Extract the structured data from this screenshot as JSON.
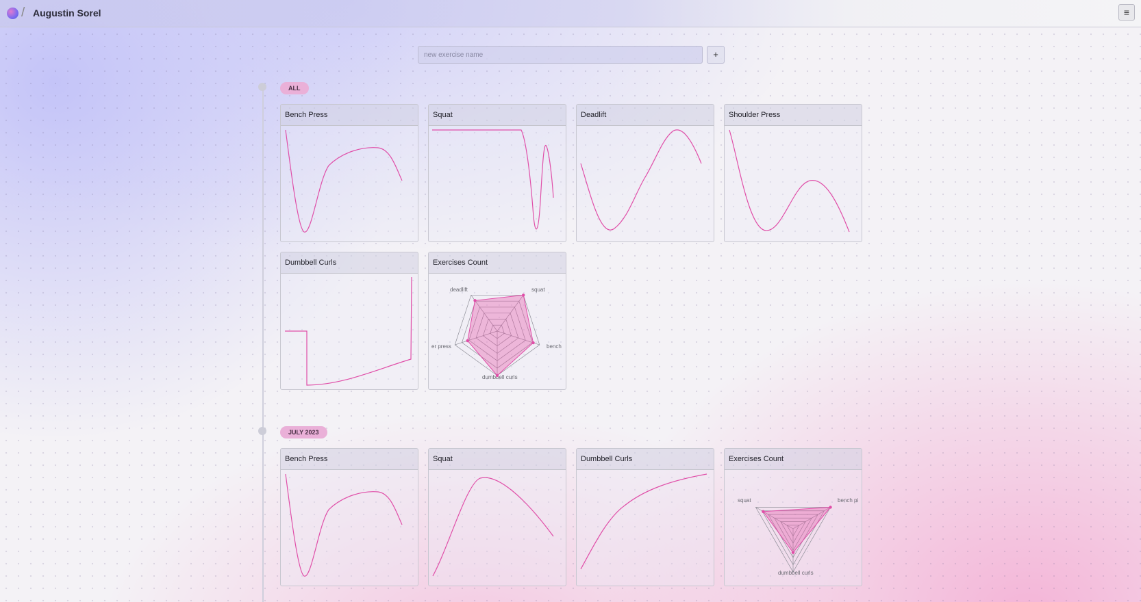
{
  "header": {
    "username": "Augustin Sorel",
    "separator": "/",
    "menu_icon": "≡"
  },
  "new_exercise": {
    "placeholder": "new exercise name",
    "add_label": "+"
  },
  "sections": [
    {
      "label": "ALL",
      "cards": [
        {
          "title": "Bench Press",
          "kind": "line"
        },
        {
          "title": "Squat",
          "kind": "line"
        },
        {
          "title": "Deadlift",
          "kind": "line"
        },
        {
          "title": "Shoulder Press",
          "kind": "line"
        },
        {
          "title": "Dumbbell Curls",
          "kind": "line"
        },
        {
          "title": "Exercises Count",
          "kind": "radar"
        }
      ]
    },
    {
      "label": "JULY 2023",
      "cards": [
        {
          "title": "Bench Press",
          "kind": "line"
        },
        {
          "title": "Squat",
          "kind": "line"
        },
        {
          "title": "Dumbbell Curls",
          "kind": "line"
        },
        {
          "title": "Exercises Count",
          "kind": "radar"
        }
      ]
    }
  ],
  "radar_all": {
    "axes": [
      "squat",
      "bench",
      "dumbbell curls",
      "er press",
      "deadlift"
    ],
    "values": [
      1.0,
      0.85,
      1.0,
      0.7,
      0.85
    ]
  },
  "radar_july": {
    "axes": [
      "bench pi",
      "dumbbell curls",
      "squat"
    ],
    "values": [
      1.0,
      0.55,
      0.8
    ]
  },
  "colors": {
    "accent": "#e04ea8",
    "pill": "#eab0d8"
  }
}
